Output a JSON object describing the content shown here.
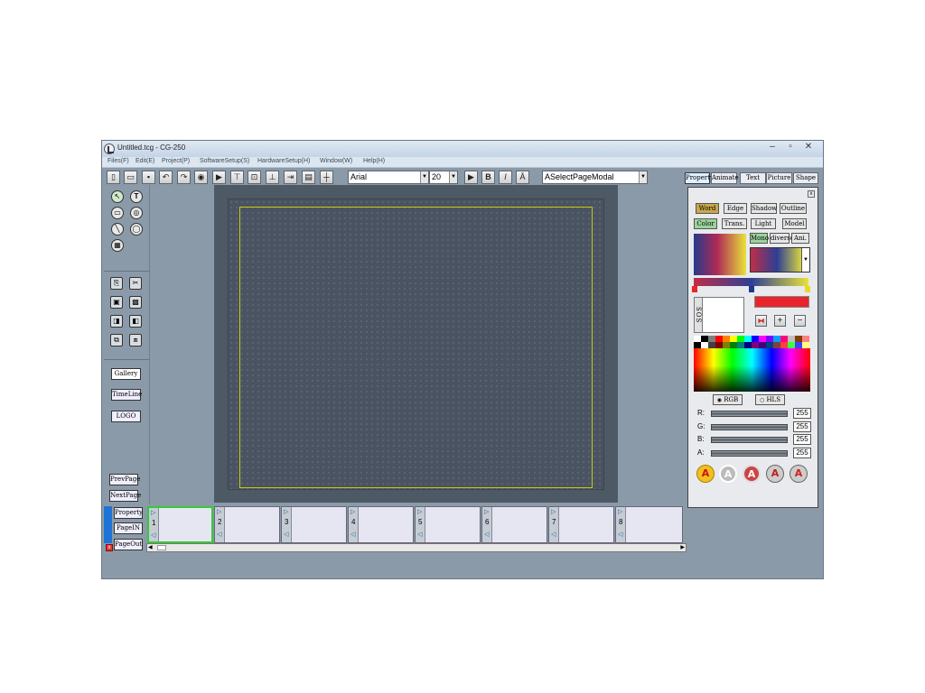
{
  "window": {
    "title": "Untitled.tcg - CG-250"
  },
  "menu": [
    "Files(F)",
    "Edit(E)",
    "Project(P)",
    "SoftwareSetup(S)",
    "HardwareSetup(H)",
    "Window(W)",
    "Help(H)"
  ],
  "toolbar": {
    "font_family": "Arial",
    "font_size": "20",
    "bold": "B",
    "italic": "I",
    "page_modal": "ASelectPageModal"
  },
  "panel_tabs": [
    "Property",
    "Animate",
    "Text",
    "Picture",
    "Shape"
  ],
  "left_panel": {
    "gallery": "Gallery",
    "timeline": "TimeLine",
    "logo": "LOGO",
    "prev_page": "PrevPage",
    "next_page": "NextPage"
  },
  "properties": {
    "tabs_row1": [
      "Word",
      "Edge",
      "Shadow",
      "Outline"
    ],
    "tabs_row2": [
      "Color",
      "Trans.",
      "Light",
      "Model"
    ],
    "fill_modes": [
      "Mono",
      "diverse",
      "Ani."
    ],
    "sos_label": "SOS",
    "plus": "+",
    "minus": "−",
    "color_models": [
      "RGB",
      "HLS"
    ],
    "channels": [
      {
        "label": "R:",
        "value": "255"
      },
      {
        "label": "G:",
        "value": "255"
      },
      {
        "label": "B:",
        "value": "255"
      },
      {
        "label": "A:",
        "value": "255"
      }
    ],
    "style_letter": "A"
  },
  "strip": {
    "property": "Property",
    "page_in": "PageIN",
    "page_out": "PageOut",
    "pages": [
      "1",
      "2",
      "3",
      "4",
      "5",
      "6",
      "7",
      "8"
    ]
  },
  "colors": {
    "frame_yellow": "#c8c810",
    "active_slot": "#33cc33",
    "swatch_red": "#e8242c"
  }
}
